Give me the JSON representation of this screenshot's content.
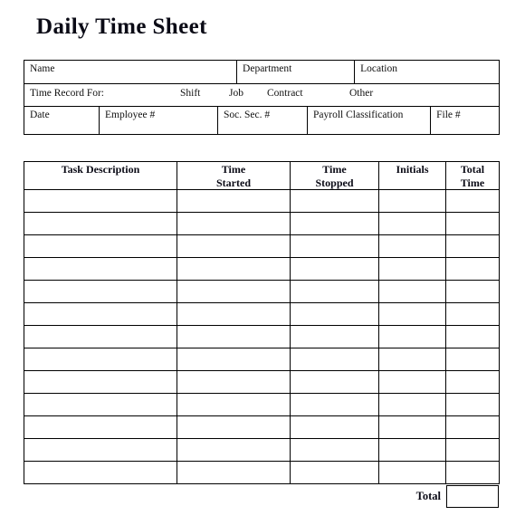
{
  "document": {
    "title": "Daily Time Sheet"
  },
  "info_table": {
    "row1": [
      {
        "label": "Name"
      },
      {
        "label": "Department"
      },
      {
        "label": "Location"
      }
    ],
    "row2": {
      "title": "Time Record For:",
      "options": [
        "Shift",
        "Job",
        "Contract",
        "Other"
      ]
    },
    "row3": [
      {
        "label": "Date"
      },
      {
        "label": "Employee #"
      },
      {
        "label": "Soc. Sec. #"
      },
      {
        "label": "Payroll Classification"
      },
      {
        "label": "File #"
      }
    ]
  },
  "task_table": {
    "headers": [
      "Task Description",
      "Time\nStarted",
      "Time\nStopped",
      "Initials",
      "Total\nTime"
    ],
    "row_count": 13,
    "rows": [
      [
        "",
        "",
        "",
        "",
        ""
      ],
      [
        "",
        "",
        "",
        "",
        ""
      ],
      [
        "",
        "",
        "",
        "",
        ""
      ],
      [
        "",
        "",
        "",
        "",
        ""
      ],
      [
        "",
        "",
        "",
        "",
        ""
      ],
      [
        "",
        "",
        "",
        "",
        ""
      ],
      [
        "",
        "",
        "",
        "",
        ""
      ],
      [
        "",
        "",
        "",
        "",
        ""
      ],
      [
        "",
        "",
        "",
        "",
        ""
      ],
      [
        "",
        "",
        "",
        "",
        ""
      ],
      [
        "",
        "",
        "",
        "",
        ""
      ],
      [
        "",
        "",
        "",
        "",
        ""
      ],
      [
        "",
        "",
        "",
        "",
        ""
      ]
    ]
  },
  "footer": {
    "total_label": "Total",
    "total_value": ""
  },
  "colors": {
    "page_background": "#ffffff",
    "border": "#000000",
    "text": "#111111",
    "heading_text": "#0b0b16"
  }
}
